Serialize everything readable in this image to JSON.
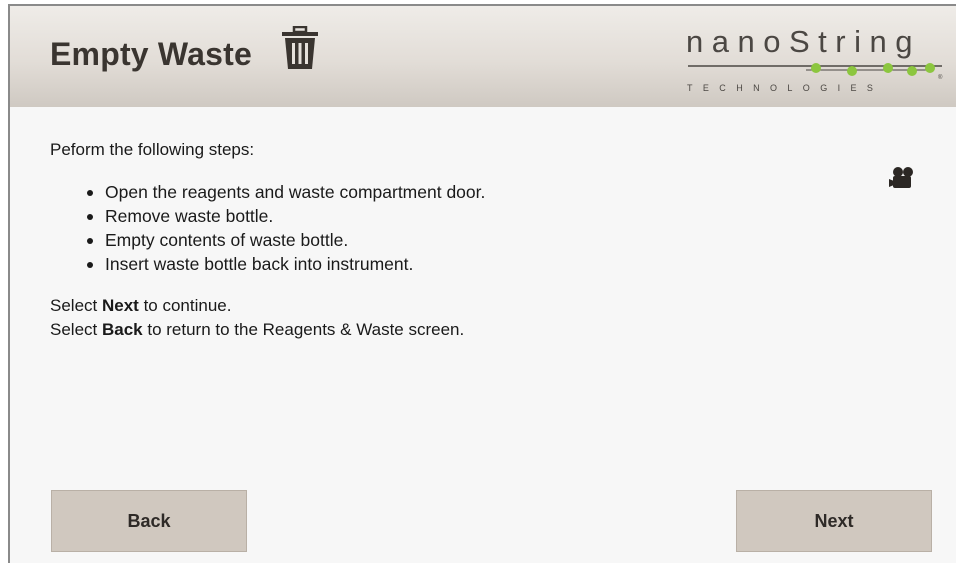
{
  "header": {
    "title": "Empty Waste",
    "title_icon": "trash-can-icon",
    "logo": {
      "wordmark": "nanoString",
      "tagline": "TECHNOLOGIES",
      "dot_color": "#8cc63f"
    }
  },
  "content": {
    "intro": "Peform the following steps:",
    "steps": [
      "Open the reagents and waste compartment door.",
      "Remove waste bottle.",
      "Empty contents of waste bottle.",
      "Insert waste bottle back into instrument."
    ],
    "next_line": {
      "prefix": "Select ",
      "keyword": "Next",
      "suffix": " to continue."
    },
    "back_line": {
      "prefix": "Select ",
      "keyword": "Back",
      "suffix": " to return to the Reagents & Waste screen."
    },
    "video_icon": "video-camera-icon"
  },
  "buttons": {
    "back_label": "Back",
    "next_label": "Next"
  },
  "colors": {
    "button_bg": "#d0c8bf",
    "header_bg": "#e2ddd7",
    "title_text": "#3a3530"
  }
}
